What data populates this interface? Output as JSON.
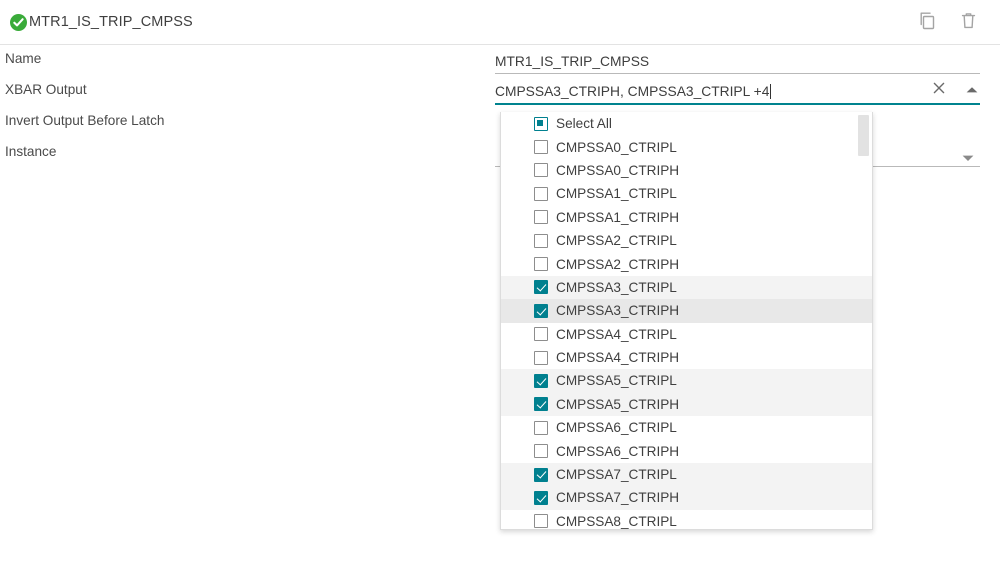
{
  "header": {
    "title": "MTR1_IS_TRIP_CMPSS",
    "status_icon": "check-circle-icon",
    "status_color": "#3aab3a",
    "copy_label": "Copy",
    "delete_label": "Delete"
  },
  "form": {
    "rows": [
      {
        "label": "Name",
        "value": "MTR1_IS_TRIP_CMPSS"
      },
      {
        "label": "XBAR Output",
        "value": "CMPSSA3_CTRIPH, CMPSSA3_CTRIPL +4"
      },
      {
        "label": "Invert Output Before Latch",
        "value": ""
      },
      {
        "label": "Instance",
        "value": ""
      }
    ]
  },
  "xbar_field": {
    "value": "CMPSSA3_CTRIPH, CMPSSA3_CTRIPL +4",
    "clear_icon": "close-icon",
    "collapse_icon": "chevron-up-icon",
    "focus_color": "#00838f",
    "focused": true
  },
  "instance_field": {
    "value": "",
    "dropdown_icon": "chevron-down-icon"
  },
  "dropdown": {
    "accent_color": "#00808f",
    "selected_row_color": "#f3f3f3",
    "hover_row_color": "#e8e8e8",
    "scrollbar_color": "#e2e2e2",
    "items": [
      {
        "label": "Select All",
        "state": "indeterminate",
        "row": "plain"
      },
      {
        "label": "CMPSSA0_CTRIPL",
        "state": "unchecked",
        "row": "plain"
      },
      {
        "label": "CMPSSA0_CTRIPH",
        "state": "unchecked",
        "row": "plain"
      },
      {
        "label": "CMPSSA1_CTRIPL",
        "state": "unchecked",
        "row": "plain"
      },
      {
        "label": "CMPSSA1_CTRIPH",
        "state": "unchecked",
        "row": "plain"
      },
      {
        "label": "CMPSSA2_CTRIPL",
        "state": "unchecked",
        "row": "plain"
      },
      {
        "label": "CMPSSA2_CTRIPH",
        "state": "unchecked",
        "row": "plain"
      },
      {
        "label": "CMPSSA3_CTRIPL",
        "state": "checked",
        "row": "selected"
      },
      {
        "label": "CMPSSA3_CTRIPH",
        "state": "checked",
        "row": "hover"
      },
      {
        "label": "CMPSSA4_CTRIPL",
        "state": "unchecked",
        "row": "plain"
      },
      {
        "label": "CMPSSA4_CTRIPH",
        "state": "unchecked",
        "row": "plain"
      },
      {
        "label": "CMPSSA5_CTRIPL",
        "state": "checked",
        "row": "selected"
      },
      {
        "label": "CMPSSA5_CTRIPH",
        "state": "checked",
        "row": "selected"
      },
      {
        "label": "CMPSSA6_CTRIPL",
        "state": "unchecked",
        "row": "plain"
      },
      {
        "label": "CMPSSA6_CTRIPH",
        "state": "unchecked",
        "row": "plain"
      },
      {
        "label": "CMPSSA7_CTRIPL",
        "state": "checked",
        "row": "selected"
      },
      {
        "label": "CMPSSA7_CTRIPH",
        "state": "checked",
        "row": "selected"
      },
      {
        "label": "CMPSSA8_CTRIPL",
        "state": "unchecked",
        "row": "plain"
      }
    ]
  }
}
